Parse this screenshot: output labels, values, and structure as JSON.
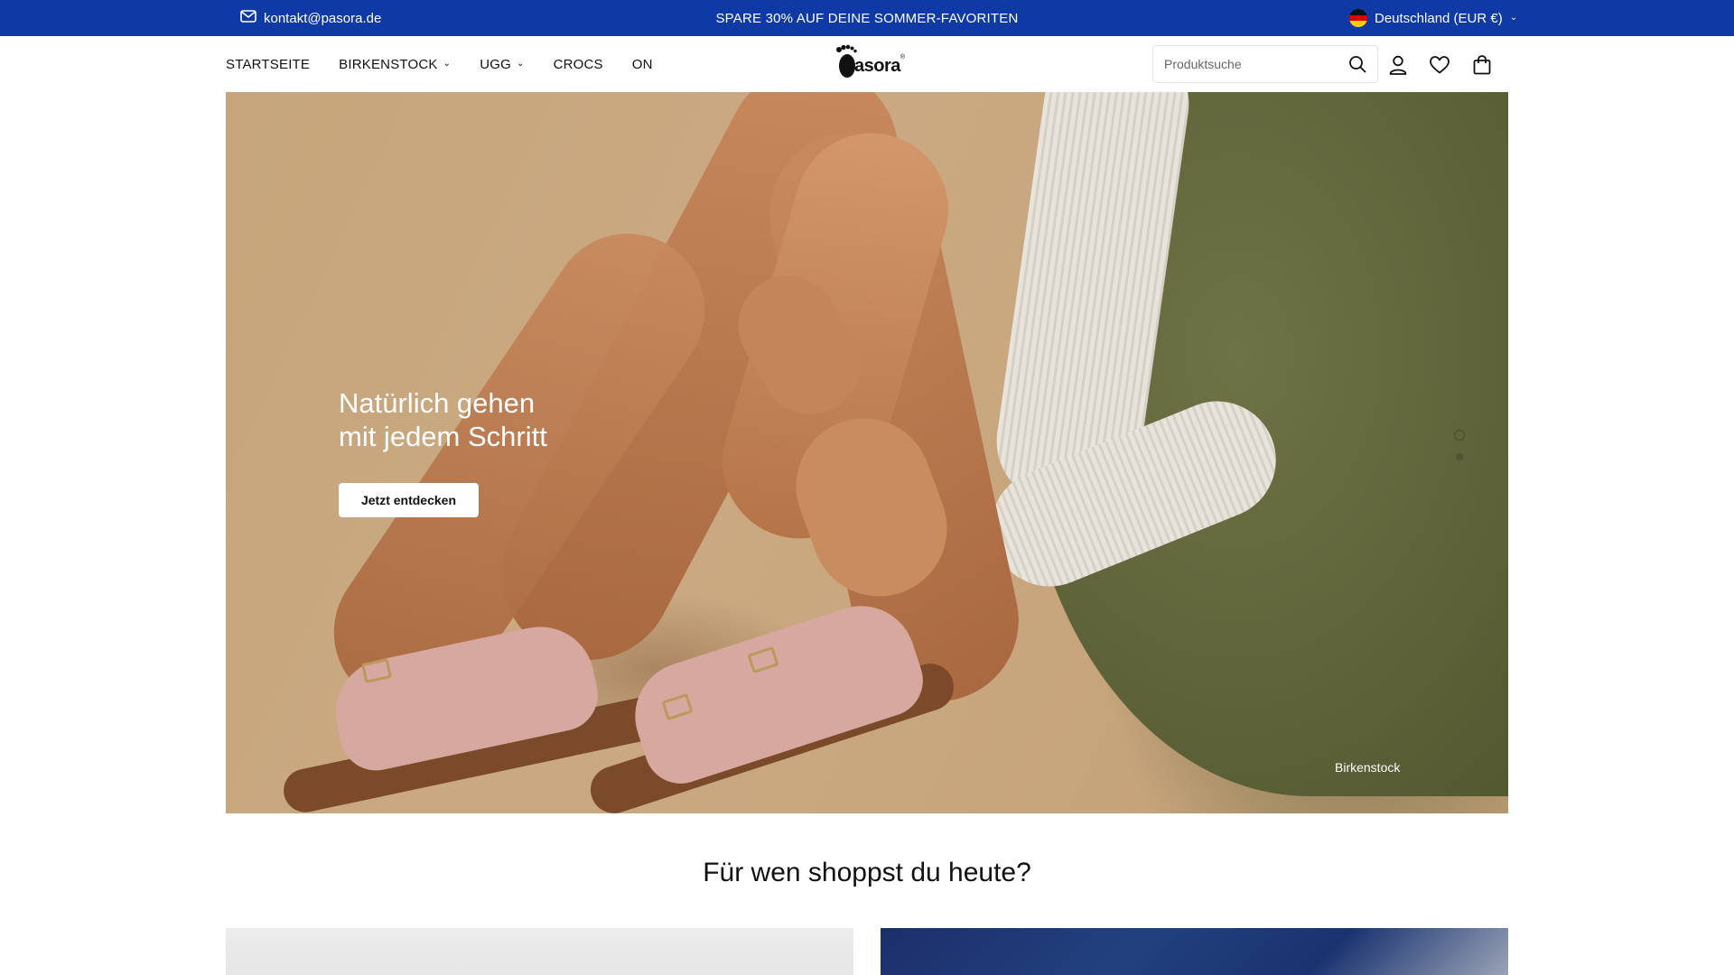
{
  "topbar": {
    "email": "kontakt@pasora.de",
    "promo": "SPARE 30% AUF DEINE SOMMER-FAVORITEN",
    "locale": "Deutschland (EUR €)",
    "bg_color": "#0f3aa6",
    "email_icon": "mail-icon",
    "flag_icon": "germany-flag-icon"
  },
  "nav": {
    "items": [
      {
        "label": "STARTSEITE",
        "has_dropdown": false
      },
      {
        "label": "BIRKENSTOCK",
        "has_dropdown": true
      },
      {
        "label": "UGG",
        "has_dropdown": true
      },
      {
        "label": "CROCS",
        "has_dropdown": false
      },
      {
        "label": "ON",
        "has_dropdown": false
      }
    ]
  },
  "logo": {
    "text": "asora",
    "mark": "®"
  },
  "search": {
    "placeholder": "Produktsuche",
    "value": ""
  },
  "header_icons": [
    "search-icon",
    "account-icon",
    "wishlist-heart-icon",
    "cart-bag-icon"
  ],
  "hero": {
    "title_line1": "Natürlich gehen",
    "title_line2": "mit jedem Schritt",
    "cta": "Jetzt entdecken",
    "caption": "Birkenstock",
    "slide_count": 2,
    "active_slide": 1
  },
  "section": {
    "title": "Für wen shoppst du heute?"
  }
}
